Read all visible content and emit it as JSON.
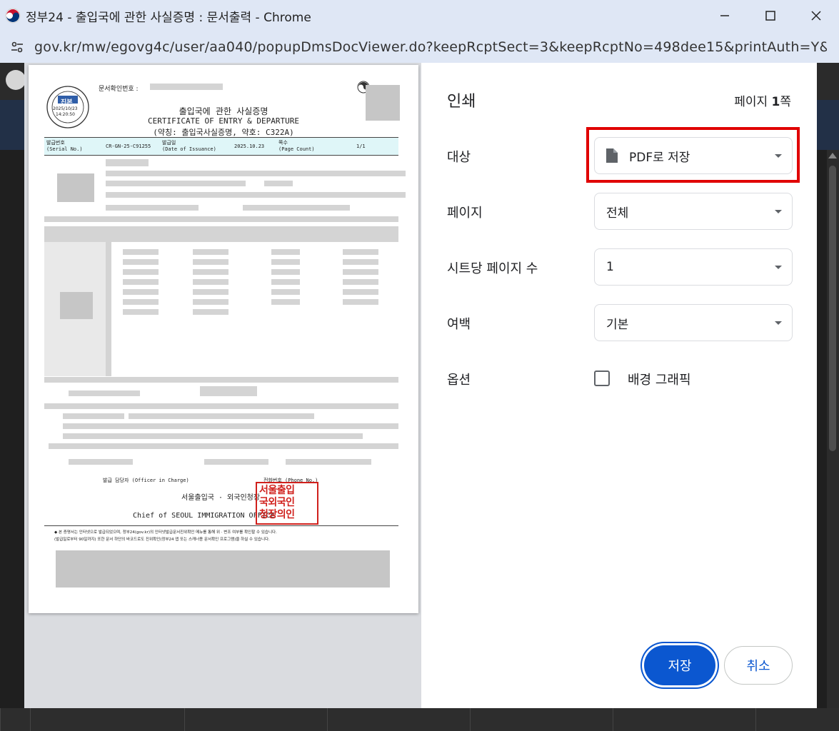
{
  "window": {
    "title": "정부24 - 출입국에 관한 사실증명 : 문서출력 - Chrome",
    "url": "gov.kr/mw/egovg4c/user/aa040/popupDmsDocViewer.do?keepRcptSect=3&keepRcptNo=498dee15&printAuth=Y&w..."
  },
  "print": {
    "title": "인쇄",
    "page_count_prefix": "페이지 ",
    "page_count_num": "1",
    "page_count_suffix": "쪽",
    "destination_label": "대상",
    "destination_value": "PDF로 저장",
    "pages_label": "페이지",
    "pages_value": "전체",
    "pages_per_sheet_label": "시트당 페이지 수",
    "pages_per_sheet_value": "1",
    "margins_label": "여백",
    "margins_value": "기본",
    "options_label": "옵션",
    "background_graphics_label": "배경 그래픽",
    "background_graphics_checked": false,
    "save_button": "저장",
    "cancel_button": "취소"
  },
  "certificate": {
    "doc_number_label": "문서확인번호 :",
    "title_ko": "출입국에 관한 사실증명",
    "title_en": "CERTIFICATE OF ENTRY & DEPARTURE",
    "abbrev": "(약칭: 출입국사실증명, 약호: C322A)",
    "stamp_seal": "진본",
    "stamp_date": "2025/10/23",
    "stamp_time": "14:20:50",
    "serial_label_ko": "발급번호",
    "serial_label_en": "(Serial No.)",
    "serial_value": "CR-GN-25-C91255",
    "issue_label_ko": "발급일",
    "issue_label_en": "(Date of Issuance)",
    "issue_value": "2025.10.23",
    "pages_label_ko": "쪽수",
    "pages_label_en": "(Page Count)",
    "pages_value": "1/1",
    "officer_label": "발급 담당자 (Officer in Charge)",
    "phone_label": "전화번호 (Phone No.)",
    "office_ko": "서울출입국 · 외국인청장",
    "office_en": "Chief of SEOUL IMMIGRATION OFFICE",
    "seal_lines": [
      "서울출입",
      "국외국인",
      "청장의인"
    ],
    "notice_line1": "◆ 본 증명서는 인터넷으로 발급되었으며, 정부24(gov.kr)의 인터넷발급문서진위확인 메뉴를 통해 위 · 변조 여부를 확인할 수 있습니다.",
    "notice_line2": "(발급일로부터 90일까지) 또한 문서 하단의 바코드로도 진위확인(정부24 앱 또는 스캐너용 문서확인 프로그램)을 하실 수 있습니다."
  }
}
